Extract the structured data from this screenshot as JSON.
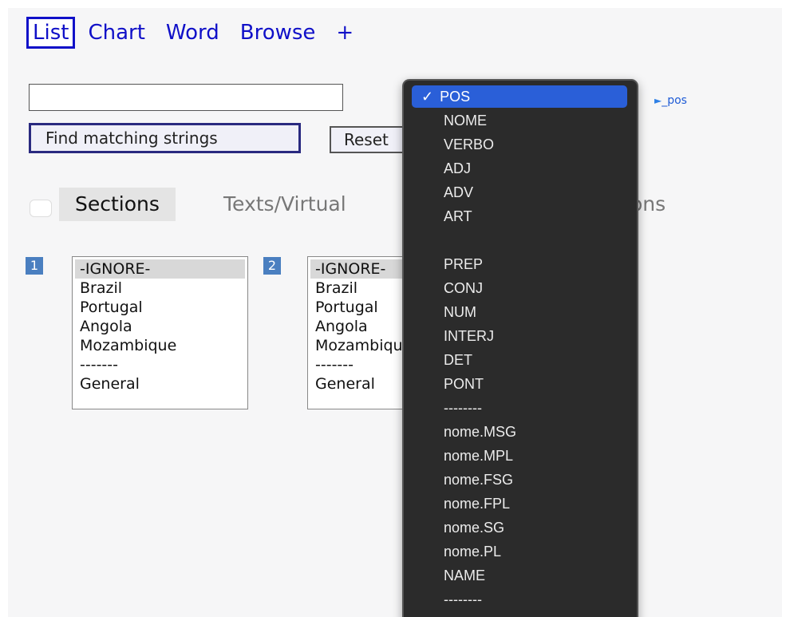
{
  "nav": {
    "tabs": [
      {
        "label": "List",
        "active": true
      },
      {
        "label": "Chart"
      },
      {
        "label": "Word"
      },
      {
        "label": "Browse"
      },
      {
        "label": "+"
      }
    ]
  },
  "search": {
    "value": "",
    "placeholder": ""
  },
  "buttons": {
    "find": "Find matching strings",
    "reset": "Reset"
  },
  "pos_link": {
    "icon": "triangle-right-icon",
    "label": "_pos"
  },
  "sections": {
    "checkbox_checked": false,
    "tabs": [
      "Sections",
      "Texts/Virtual",
      "ons"
    ]
  },
  "lists": [
    {
      "number": "1",
      "items": [
        "-IGNORE-",
        "Brazil",
        "Portugal",
        "Angola",
        "Mozambique",
        "-------",
        "General"
      ]
    },
    {
      "number": "2",
      "items": [
        "-IGNORE-",
        "Brazil",
        "Portugal",
        "Angola",
        "Mozambique",
        "-------",
        "General"
      ]
    }
  ],
  "dropdown": {
    "selected_check": "✓",
    "items": [
      "POS",
      "NOME",
      "VERBO",
      "ADJ",
      "ADV",
      "ART",
      "",
      "PREP",
      "CONJ",
      "NUM",
      "INTERJ",
      "DET",
      "PONT",
      "--------",
      "nome.MSG",
      "nome.MPL",
      "nome.FSG",
      "nome.FPL",
      "nome.SG",
      "nome.PL",
      "NAME",
      "--------"
    ]
  },
  "colors": {
    "link": "#1010c8",
    "selected": "#2a5fd8",
    "menu_bg": "#2b2b2b",
    "badge": "#4a7fc0"
  }
}
